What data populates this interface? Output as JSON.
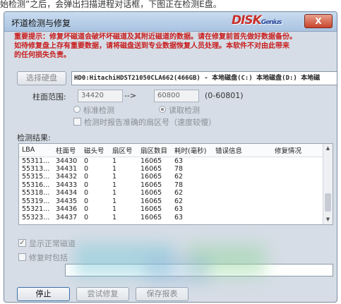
{
  "caption": "始检测”之后，会弹出扫描进程对话框，下图正在检测E盘。",
  "dialog": {
    "title": "坏道检测与修复",
    "close_label": "X",
    "logo_text": "DISK",
    "logo_sub": "Genius"
  },
  "warning": [
    "重要提示：修复坏磁道会破坏坏磁道及其附近磁道的数据。请在修复前首先做好数据备份。",
    "如待修复盘上存有重要数据，请将磁盘送到专业数据恢复人员处理。本软件不对由此带来",
    "的任何损失负责。"
  ],
  "disk": {
    "select_label": "选择硬盘",
    "value": "HD0:HitachiHDST21050CLA662(466GB) - 本地磁盘(C:) 本地磁盘(D:) 本地磁"
  },
  "range": {
    "label": "柱面范围:",
    "start": "34420",
    "arrow": "-->",
    "end": "60800",
    "total": "(0-60801)"
  },
  "options": {
    "standard": "标准检测",
    "read": "读取检测",
    "report_sector": "检测时报告准确的扇区号（速度较慢）"
  },
  "results": {
    "label": "检测结果:",
    "columns": [
      "LBA",
      "柱面号",
      "磁头号",
      "扇区号",
      "扇区数目",
      "耗时(毫秒)",
      "错误信息",
      "修复情况"
    ],
    "rows": [
      [
        "55311...",
        "34430",
        "0",
        "1",
        "16065",
        "63",
        "",
        ""
      ],
      [
        "55313...",
        "34431",
        "0",
        "1",
        "16065",
        "78",
        "",
        ""
      ],
      [
        "55315...",
        "34432",
        "0",
        "1",
        "16065",
        "62",
        "",
        ""
      ],
      [
        "55316...",
        "34433",
        "0",
        "1",
        "16065",
        "78",
        "",
        ""
      ],
      [
        "55318...",
        "34434",
        "0",
        "1",
        "16065",
        "62",
        "",
        ""
      ],
      [
        "55319...",
        "34435",
        "0",
        "1",
        "16065",
        "62",
        "",
        ""
      ],
      [
        "55321...",
        "34436",
        "0",
        "1",
        "16065",
        "63",
        "",
        ""
      ],
      [
        "55323...",
        "34437",
        "0",
        "1",
        "16065",
        "63",
        "",
        ""
      ]
    ]
  },
  "show_normal": "显示正常磁道",
  "repair_when": "修复时包括",
  "buttons": {
    "stop": "停止",
    "try_repair": "尝试修复",
    "save_report": "保存报表"
  }
}
